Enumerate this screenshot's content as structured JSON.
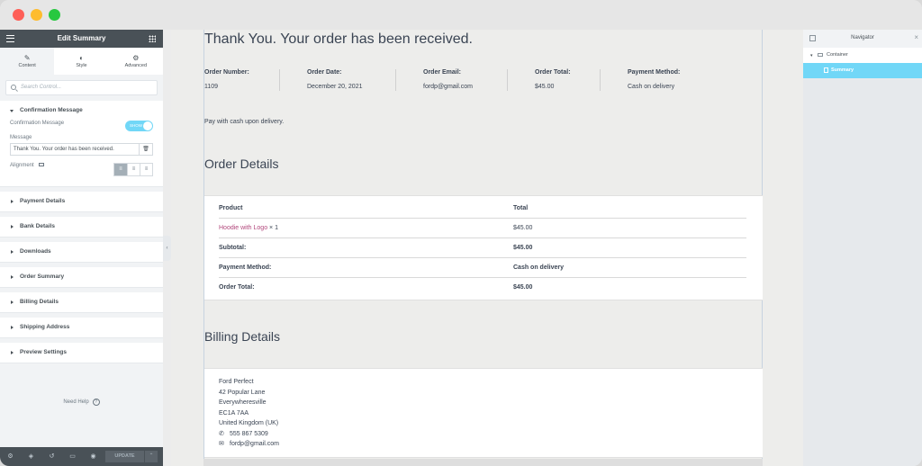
{
  "panel": {
    "title": "Edit Summary",
    "tabs": [
      {
        "label": "Content",
        "icon": "pencil-icon"
      },
      {
        "label": "Style",
        "icon": "half-circle-icon"
      },
      {
        "label": "Advanced",
        "icon": "gear-icon"
      }
    ],
    "search_placeholder": "Search Control...",
    "confirmation": {
      "section_title": "Confirmation Message",
      "toggle_label": "Confirmation Message",
      "toggle_state": "SHOW",
      "message_label": "Message",
      "message_value": "Thank You. Your order has been received.",
      "alignment_label": "Alignment"
    },
    "sections": [
      "Payment Details",
      "Bank Details",
      "Downloads",
      "Order Summary",
      "Billing Details",
      "Shipping Address",
      "Preview Settings"
    ],
    "help_label": "Need Help",
    "update_label": "UPDATE"
  },
  "canvas": {
    "thanks": "Thank You. Your order has been received.",
    "overview": [
      {
        "label": "Order Number:",
        "value": "1109"
      },
      {
        "label": "Order Date:",
        "value": "December 20, 2021"
      },
      {
        "label": "Order Email:",
        "value": "fordp@gmail.com"
      },
      {
        "label": "Order Total:",
        "value": "$45.00"
      },
      {
        "label": "Payment Method:",
        "value": "Cash on delivery"
      }
    ],
    "pay_note": "Pay with cash upon delivery.",
    "order_details_title": "Order Details",
    "order_table": {
      "headers": [
        "Product",
        "Total"
      ],
      "product_name": "Hoodie with Logo",
      "product_qty": "× 1",
      "product_total": "$45.00",
      "rows": [
        {
          "label": "Subtotal:",
          "value": "$45.00"
        },
        {
          "label": "Payment Method:",
          "value": "Cash on delivery"
        },
        {
          "label": "Order Total:",
          "value": "$45.00"
        }
      ]
    },
    "billing_title": "Billing Details",
    "billing": {
      "name": "Ford Perfect",
      "street": "42 Popular Lane",
      "city": "Everywheresville",
      "postcode": "EC1A 7AA",
      "country": "United Kingdom (UK)",
      "phone": "555 867 5309",
      "email": "fordp@gmail.com"
    }
  },
  "navigator": {
    "title": "Navigator",
    "items": [
      "Container",
      "Summary"
    ]
  },
  "colors": {
    "panel_header": "#495157",
    "accent": "#71d7f7",
    "product_link": "#b2487c"
  }
}
